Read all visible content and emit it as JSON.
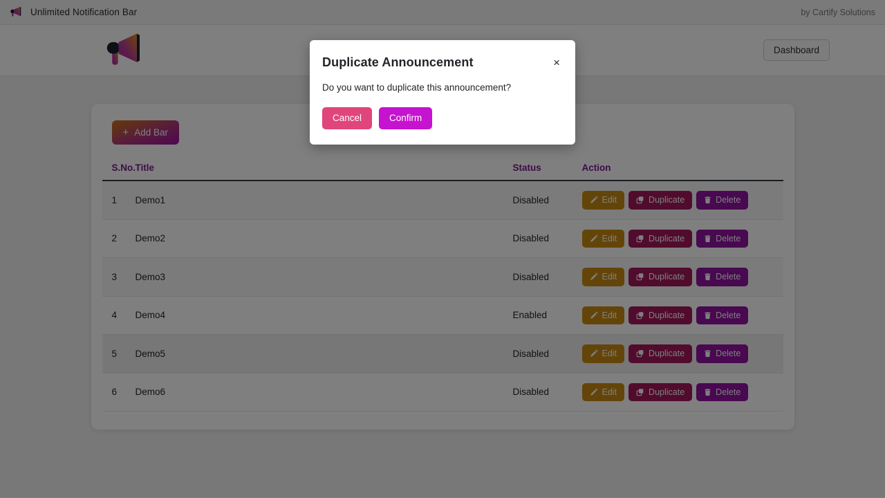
{
  "topbar": {
    "icon": "megaphone-icon",
    "title": "Unlimited Notification Bar",
    "credit": "by Cartify Solutions"
  },
  "header": {
    "logo_icon": "megaphone-logo",
    "dashboard_label": "Dashboard"
  },
  "toolbar": {
    "add_bar_plus": "+",
    "add_bar_label": "Add Bar"
  },
  "table": {
    "columns": [
      "S.No.",
      "Title",
      "Status",
      "Action"
    ],
    "actions": {
      "edit_label": "Edit",
      "duplicate_label": "Duplicate",
      "delete_label": "Delete"
    },
    "rows": [
      {
        "sno": "1",
        "title": "Demo1",
        "status": "Disabled"
      },
      {
        "sno": "2",
        "title": "Demo2",
        "status": "Disabled"
      },
      {
        "sno": "3",
        "title": "Demo3",
        "status": "Disabled"
      },
      {
        "sno": "4",
        "title": "Demo4",
        "status": "Enabled"
      },
      {
        "sno": "5",
        "title": "Demo5",
        "status": "Disabled"
      },
      {
        "sno": "6",
        "title": "Demo6",
        "status": "Disabled"
      }
    ]
  },
  "modal": {
    "title": "Duplicate Announcement",
    "close_label": "×",
    "message": "Do you want to duplicate this announcement?",
    "cancel_label": "Cancel",
    "confirm_label": "Confirm"
  },
  "colors": {
    "accent_purple": "#7b1a8c",
    "edit": "#c98a12",
    "duplicate": "#a3185a",
    "delete": "#9013a0",
    "cancel": "#e0457b",
    "confirm": "#c513cf"
  }
}
